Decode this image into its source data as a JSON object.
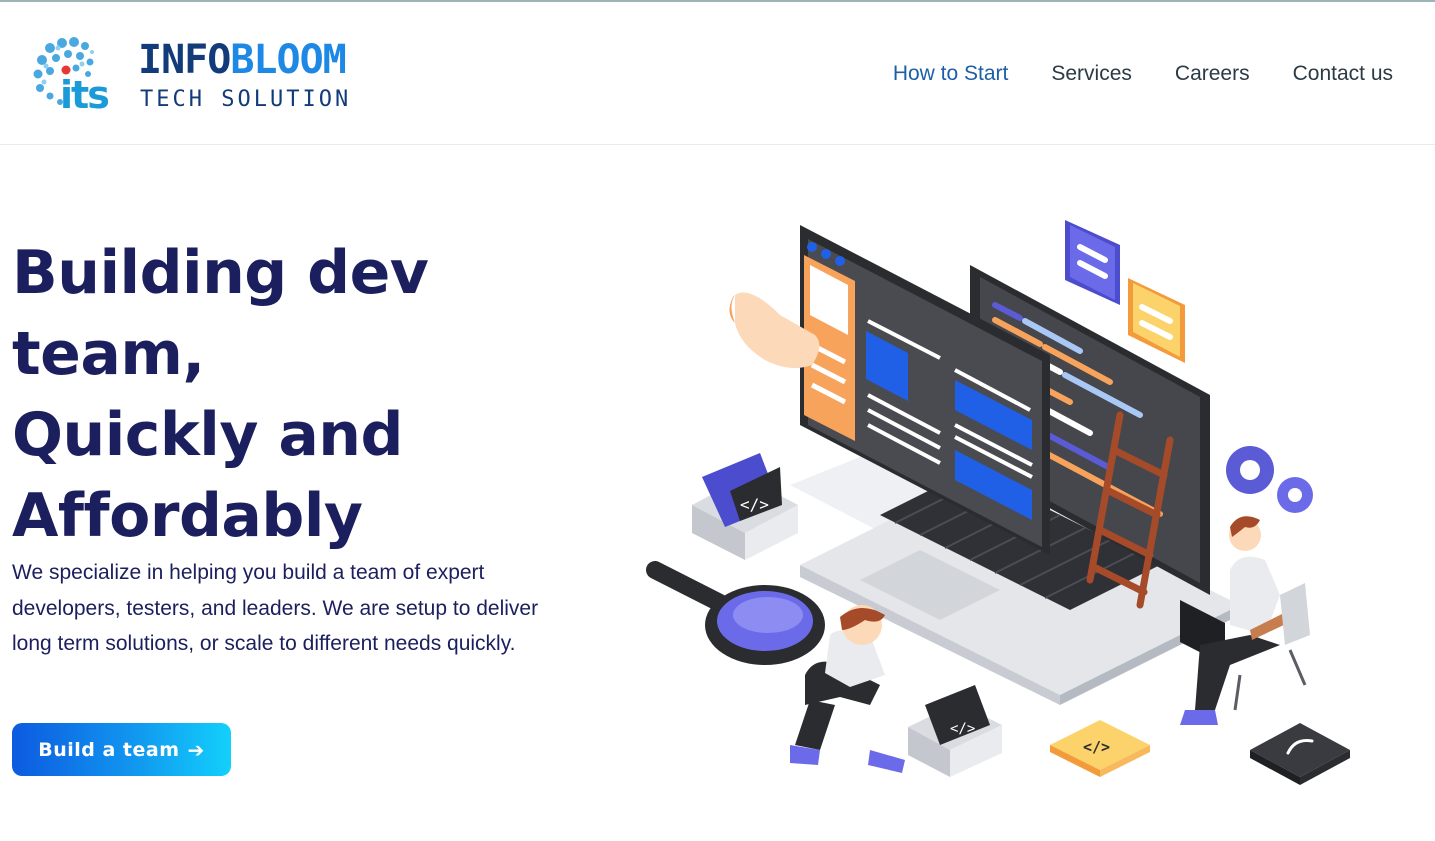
{
  "brand": {
    "name_part1": "INFO",
    "name_part2": "BLOOM",
    "tagline": "TECH SOLUTION",
    "mark_letters": "its"
  },
  "nav": {
    "items": [
      {
        "label": "How to Start",
        "active": true
      },
      {
        "label": "Services",
        "active": false
      },
      {
        "label": "Careers",
        "active": false
      },
      {
        "label": "Contact us",
        "active": false
      }
    ]
  },
  "hero": {
    "title_lines": [
      "Building dev",
      "team,",
      "Quickly and",
      "Affordably"
    ],
    "description": "We specialize in helping you build a team of expert developers, testers, and leaders. We are setup to deliver long term solutions, or scale to different needs quickly.",
    "cta_label": "Build a team",
    "cta_icon": "arrow-right-icon"
  },
  "illustration": {
    "code_tag": "</>"
  },
  "colors": {
    "heading": "#1b1f5e",
    "nav_active": "#1c5fa8",
    "nav_text": "#2c3a44",
    "cta_gradient_start": "#0d5ae0",
    "cta_gradient_end": "#13d0fb",
    "accent_purple": "#5b5bd6",
    "accent_orange": "#f7a35c",
    "accent_yellow": "#fcd36b"
  }
}
